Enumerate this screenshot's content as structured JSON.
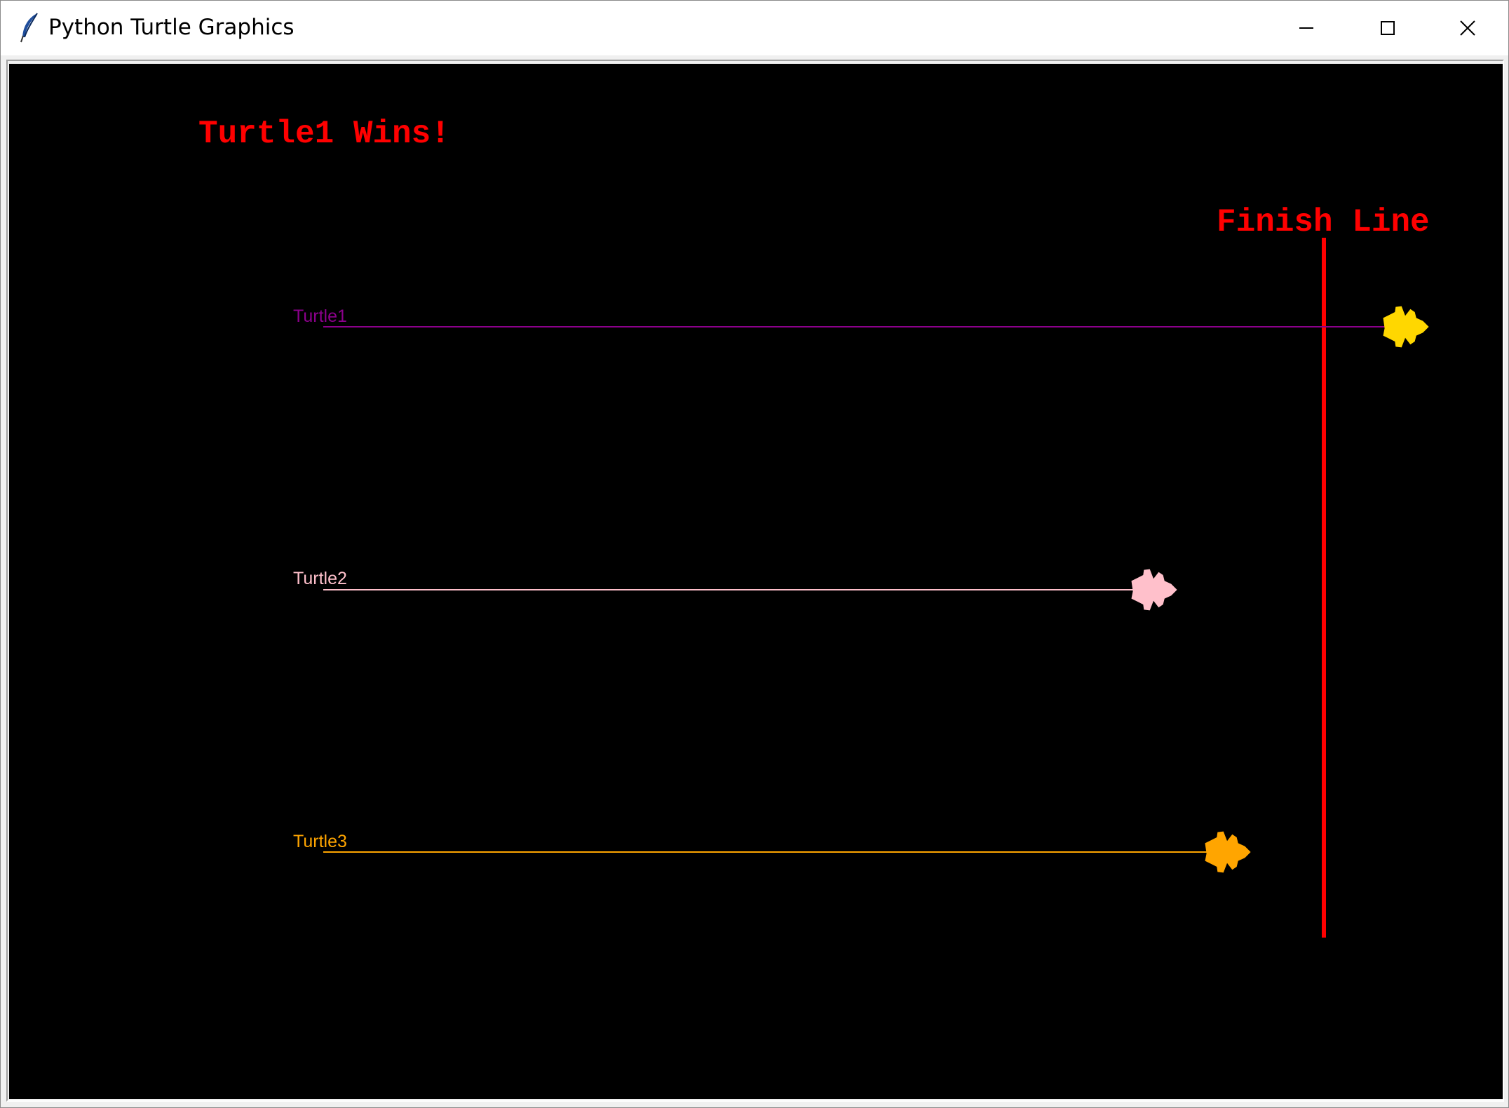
{
  "window": {
    "title": "Python Turtle Graphics",
    "icons": {
      "app": "feather-icon",
      "minimize": "minimize-icon",
      "maximize": "maximize-icon",
      "close": "close-icon"
    }
  },
  "game": {
    "background_color": "#000000",
    "winner_text": "Turtle1 Wins!",
    "winner_color": "#ff0000",
    "finish_label": "Finish Line",
    "finish_color": "#ff0000",
    "racers": [
      {
        "name": "Turtle1",
        "color": "#8b008b",
        "turtle_color": "#ffd700",
        "icon": "turtle-icon"
      },
      {
        "name": "Turtle2",
        "color": "#ffc0cb",
        "turtle_color": "#ffc0cb",
        "icon": "turtle-icon"
      },
      {
        "name": "Turtle3",
        "color": "#ffa500",
        "turtle_color": "#ffa500",
        "icon": "turtle-icon"
      }
    ]
  }
}
